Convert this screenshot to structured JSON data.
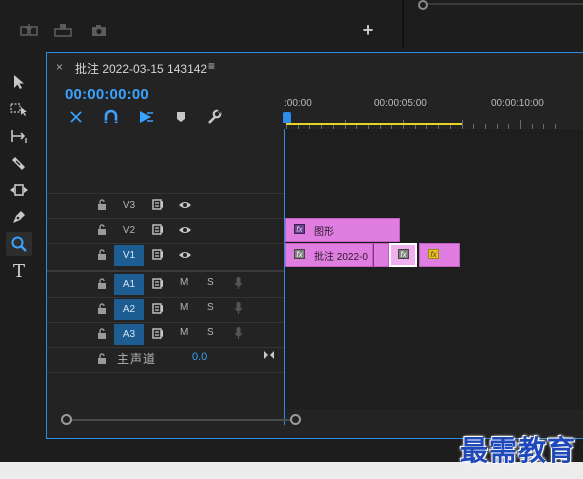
{
  "top_bar": {
    "tools": [
      "export-frame-icon",
      "lift-icon",
      "camera-icon"
    ],
    "add_symbol": "+"
  },
  "tools_panel": {
    "tools": [
      {
        "name": "selection-tool",
        "icon": "arrow-icon"
      },
      {
        "name": "track-select-tool",
        "icon": "track-forward-icon"
      },
      {
        "name": "ripple-edit-tool",
        "icon": "ripple-icon"
      },
      {
        "name": "razor-tool",
        "icon": "razor-icon"
      },
      {
        "name": "slip-tool",
        "icon": "slip-icon"
      },
      {
        "name": "pen-tool",
        "icon": "pen-icon"
      },
      {
        "name": "zoom-tool",
        "icon": "magnifier-icon",
        "active": true
      },
      {
        "name": "type-tool",
        "icon": "type-icon",
        "glyph": "T"
      }
    ]
  },
  "timeline": {
    "close": "×",
    "title": "批注 2022-03-15 143142",
    "menu": "≡",
    "timecode": "00:00:00:00",
    "ruler": {
      "labels": [
        ":00:00",
        "00:00:05:00",
        "00:00:10:00"
      ]
    },
    "video_tracks": [
      {
        "name": "V3",
        "targeted": false
      },
      {
        "name": "V2",
        "targeted": false
      },
      {
        "name": "V1",
        "targeted": true
      }
    ],
    "audio_tracks": [
      {
        "name": "A1",
        "mute": "M",
        "solo": "S"
      },
      {
        "name": "A2",
        "mute": "M",
        "solo": "S"
      },
      {
        "name": "A3",
        "mute": "M",
        "solo": "S"
      }
    ],
    "master": {
      "label": "主声道",
      "value": "0.0"
    },
    "clips": {
      "v2_clip": {
        "fx": "fx",
        "label": "图形"
      },
      "v1_clip_a": {
        "fx": "fx",
        "label": "批注 2022-0"
      },
      "v1_clip_b": {
        "fx": "fx",
        "label": ""
      },
      "v1_clip_c": {
        "fx": "fx",
        "label": ""
      }
    }
  },
  "colors": {
    "accent": "#2d8ceb",
    "clip": "#e07de0",
    "work_area": "#e6d32a",
    "timecode": "#3aa3ff"
  },
  "watermark": "最需教育"
}
